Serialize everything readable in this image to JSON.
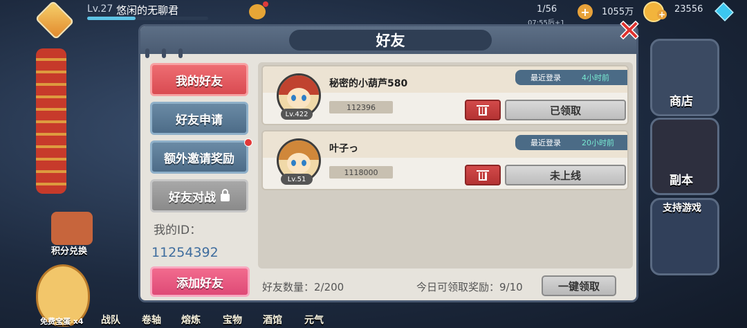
{
  "hud": {
    "level": "Lv.27",
    "player_name": "悠闲的无聊君",
    "stamina": "1/56",
    "stamina_timer": "07:55后+1",
    "gold": "1055万",
    "gems": "23556"
  },
  "background": {
    "right_buttons": [
      "商店",
      "副本",
      "支持游戏"
    ],
    "left_button": "积分兑换",
    "egg_label": "免费宝蛋 x4",
    "bottom_tabs": [
      "战队",
      "卷轴",
      "熔炼",
      "宝物",
      "酒馆",
      "元气"
    ]
  },
  "dialog": {
    "title": "好友",
    "tabs": [
      {
        "label": "我的好友",
        "state": "active"
      },
      {
        "label": "好友申请",
        "state": "normal"
      },
      {
        "label": "额外邀请奖励",
        "state": "normal",
        "badge": true
      },
      {
        "label": "好友对战",
        "state": "locked"
      }
    ],
    "my_id_label": "我的ID：",
    "my_id_value": "11254392",
    "add_friend_label": "添加好友",
    "friends": [
      {
        "name": "秘密的小葫芦580",
        "level": "Lv.422",
        "score": "112396",
        "last_login_label": "最近登录",
        "last_login_time": "4小时前",
        "action": "已领取"
      },
      {
        "name": "叶子っ",
        "level": "Lv.51",
        "score": "1118000",
        "last_login_label": "最近登录",
        "last_login_time": "20小时前",
        "action": "未上线"
      }
    ],
    "friend_count": "好友数量：2/200",
    "reward_count": "今日可领取奖励：9/10",
    "one_click_label": "一键领取"
  },
  "colors": {
    "active_tab": "#d94b52",
    "normal_tab": "#4d6c88",
    "locked_tab": "#8a8a8a",
    "add_friend": "#de4a76",
    "login_time": "#78ead1"
  }
}
